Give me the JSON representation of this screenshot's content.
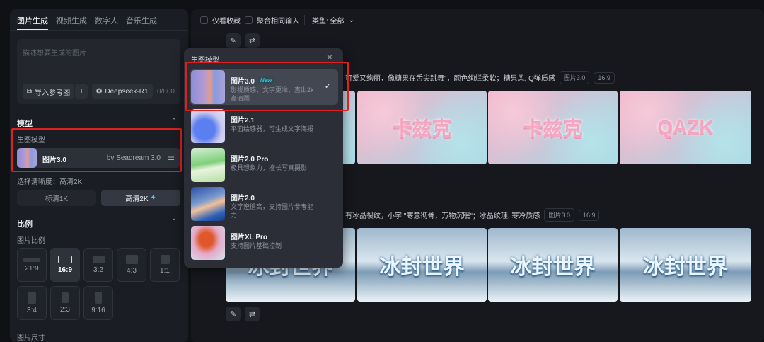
{
  "tabs": [
    "图片生成",
    "视频生成",
    "数字人",
    "音乐生成"
  ],
  "prompt": {
    "placeholder": "描述想要生成的图片",
    "import_ref": "导入参考图",
    "text_tool": "T",
    "deepseek": "Deepseek-R1",
    "count": "0/800"
  },
  "model_section": {
    "title": "模型",
    "label": "生图模型",
    "selected_name": "图片3.0",
    "selected_by": "by Seadream 3.0"
  },
  "resolution": {
    "label": "选择清晰度：高清2K",
    "options": [
      "标清1K",
      "高清2K"
    ],
    "selected": "高清2K",
    "sparkle": "✦"
  },
  "ratio_section": {
    "title": "比例",
    "label": "图片比例",
    "options": [
      "21:9",
      "16:9",
      "3:2",
      "4:3",
      "1:1",
      "3:4",
      "2:3",
      "9:16"
    ],
    "selected": "16:9",
    "next_label": "图片尺寸"
  },
  "filters": {
    "favorites": "仅看收藏",
    "merge": "聚合相同输入",
    "type": "类型: 全部"
  },
  "popup": {
    "title": "生图模型",
    "items": [
      {
        "name": "图片3.0",
        "badge": "New",
        "desc": "影视质感，文字更准，直出2k高清图",
        "selected": true
      },
      {
        "name": "图片2.1",
        "desc": "平面绘感器，可生成文字海报"
      },
      {
        "name": "图片2.0 Pro",
        "desc": "极具想象力，擅长写真摄影"
      },
      {
        "name": "图片2.0",
        "desc": "文字遵循高，支持图片参考能力"
      },
      {
        "name": "图片XL Pro",
        "desc": "支持图片基础控制"
      }
    ]
  },
  "results": [
    {
      "caption": "可爱又绚丽，像糖果在舌尖跳舞\"，颜色绚烂柔软；糖果风, Q弹质感",
      "model": "图片3.0",
      "ratio": "16:9",
      "images": [
        "",
        "卡兹克",
        "卡兹克",
        "QAZK"
      ]
    },
    {
      "caption": "有冰晶裂纹，小字 \"寒意彻骨，万物沉眠\"；冰晶纹理, 寒冷质感",
      "model": "图片3.0",
      "ratio": "16:9",
      "images": [
        "冰封世界",
        "冰封世界",
        "冰封世界",
        "冰封世界"
      ]
    }
  ]
}
